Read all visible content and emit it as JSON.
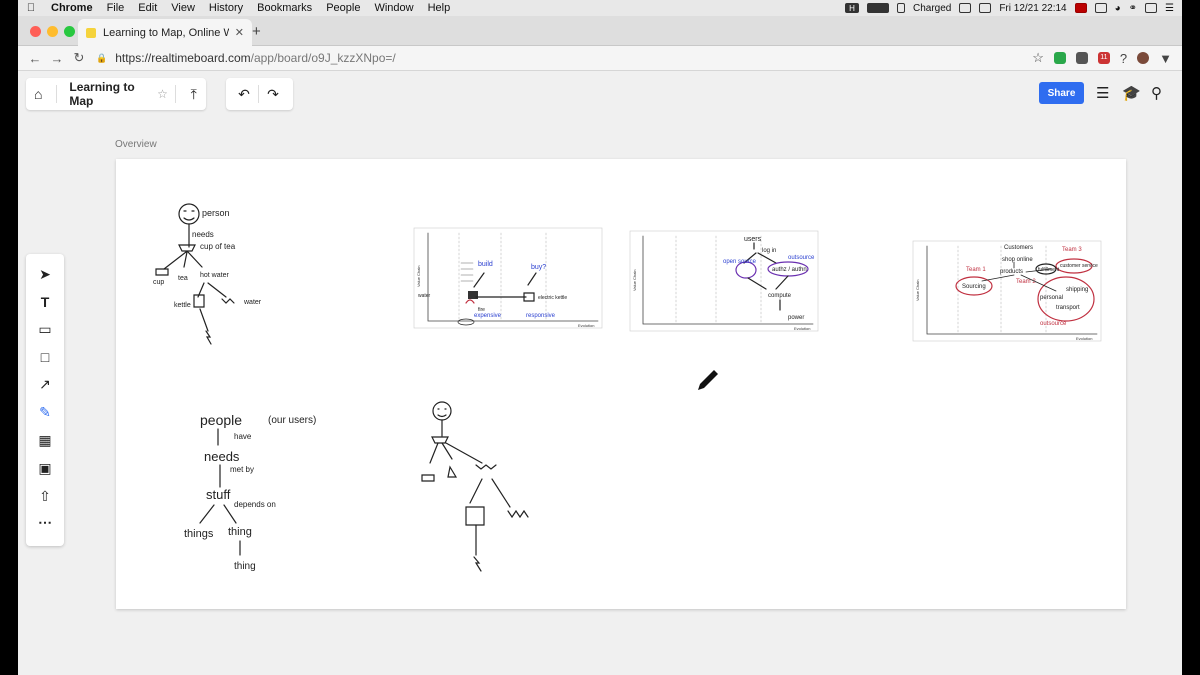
{
  "menubar": {
    "items": [
      "Chrome",
      "File",
      "Edit",
      "View",
      "History",
      "Bookmarks",
      "People",
      "Window",
      "Help"
    ],
    "status": {
      "battery": "Charged",
      "datetime": "Fri 12/21 22:14",
      "h_badge": "H"
    }
  },
  "browser": {
    "tab_title": "Learning to Map, Online Whiteb",
    "url_host": "https://realtimeboard.com",
    "url_path": "/app/board/o9J_kzzXNpo=/",
    "ext_badge": "11"
  },
  "app": {
    "board_title": "Learning to Map",
    "share_label": "Share",
    "frame_label": "Overview"
  },
  "sketches": {
    "person": {
      "label": "person",
      "needs": "needs",
      "cup": "cup of tea",
      "parts": [
        "cup",
        "tea",
        "hot water"
      ],
      "kettle": "kettle",
      "water": "water"
    },
    "people_tree": {
      "people": "people",
      "users": "(our users)",
      "have": "have",
      "needs": "needs",
      "met_by": "met by",
      "stuff": "stuff",
      "depends_on": "depends on",
      "things": "things",
      "thing1": "thing",
      "thing2": "thing"
    },
    "map1": {
      "ylabel": "Value Chain",
      "xlabel": "Evolution",
      "notes": [
        "build",
        "buy?",
        "water",
        "electric kettle",
        "fire",
        "expensive",
        "responsive"
      ]
    },
    "map2": {
      "ylabel": "Value Chain",
      "xlabel": "Evolution",
      "notes": [
        "users",
        "log in",
        "open source",
        "authz / authn",
        "outsource",
        "compute",
        "power"
      ]
    },
    "map3": {
      "ylabel": "Value Chain",
      "xlabel": "Evolution",
      "notes": [
        "Customers",
        "shop online",
        "products",
        "Team 3",
        "customer service",
        "fulfillment",
        "Team 1",
        "Sourcing",
        "Team 2",
        "personal",
        "shipping",
        "transport",
        "outsource"
      ]
    }
  },
  "colors": {
    "accent": "#2f6df0",
    "ink": "#222222",
    "blue_ink": "#2a3fd0",
    "purple_ink": "#6a2fb0",
    "red_ink": "#c03040"
  }
}
